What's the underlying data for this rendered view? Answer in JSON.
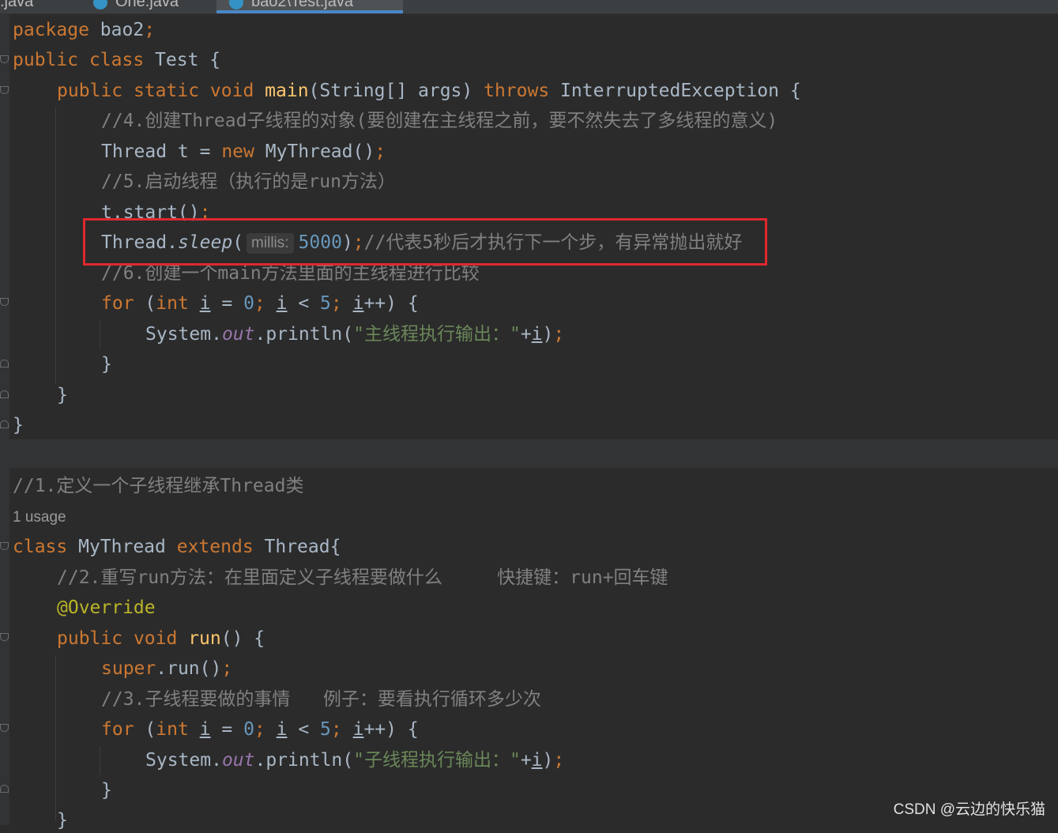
{
  "tabs": [
    {
      "label": "s.java",
      "active": false
    },
    {
      "label": "One.java",
      "active": false
    },
    {
      "label": "bao2\\Test.java",
      "active": true
    }
  ],
  "code": {
    "l1": {
      "a": "package",
      "b": " bao2",
      "c": ";"
    },
    "l2": {
      "a": "public",
      "b": "class",
      "c": " Test {"
    },
    "l3": {
      "a": "public",
      "b": "static",
      "c": "void",
      "d": "main",
      "e": "(String[] args) ",
      "f": "throws",
      "g": " InterruptedException {"
    },
    "l4": "//4.创建Thread子线程的对象(要创建在主线程之前，要不然失去了多线程的意义)",
    "l5": {
      "a": "Thread t = ",
      "b": "new",
      "c": " MyThread()",
      "d": ";"
    },
    "l6": "//5.启动线程（执行的是run方法）",
    "l7": {
      "a": "t.start()",
      "b": ";"
    },
    "l8": {
      "a": "Thread.",
      "b": "sleep",
      "c": "(",
      "hint": "millis:",
      "d": "5000",
      "e": ")",
      "f": ";",
      "g": "//代表5秒后才执行下一个步，有异常抛出就好"
    },
    "l9": "//6.创建一个main方法里面的主线程进行比较",
    "l10": {
      "a": "for",
      "b": " (",
      "c": "int",
      "d": "i",
      "e": " = ",
      "f": "0",
      "g": "; ",
      "h": "i",
      "i": " < ",
      "j": "5",
      "k": "; ",
      "l": "i",
      "m": "++) {"
    },
    "l11": {
      "a": "System.",
      "b": "out",
      "c": ".println(",
      "d": "\"主线程执行输出：\"",
      "e": "+",
      "f": "i",
      "g": ")",
      "h": ";"
    },
    "l12": "}",
    "l13": "}",
    "l14": "}",
    "l15": "//1.定义一个子线程继承Thread类",
    "usage": "1 usage",
    "l16": {
      "a": "class",
      "b": " MyThread ",
      "c": "extends",
      "d": " Thread{"
    },
    "l17": "//2.重写run方法：在里面定义子线程要做什么     快捷键：run+回车键",
    "l18": "@Override",
    "l19": {
      "a": "public",
      "b": "void",
      "c": "run",
      "d": "() {"
    },
    "l20": {
      "a": "super",
      "b": ".run()",
      "c": ";"
    },
    "l21": "//3.子线程要做的事情   例子：要看执行循环多少次",
    "l22": {
      "a": "for",
      "b": " (",
      "c": "int",
      "d": "i",
      "e": " = ",
      "f": "0",
      "g": "; ",
      "h": "i",
      "i": " < ",
      "j": "5",
      "k": "; ",
      "l": "i",
      "m": "++) {"
    },
    "l23": {
      "a": "System.",
      "b": "out",
      "c": ".println(",
      "d": "\"子线程执行输出：\"",
      "e": "+",
      "f": "i",
      "g": ")",
      "h": ";"
    },
    "l24": "}",
    "l25": "}"
  },
  "watermark": "CSDN @云边的快乐猫",
  "colors": {
    "background": "#2b2b2b",
    "keyword": "#cc7832",
    "highlight_box": "#e0282e"
  }
}
